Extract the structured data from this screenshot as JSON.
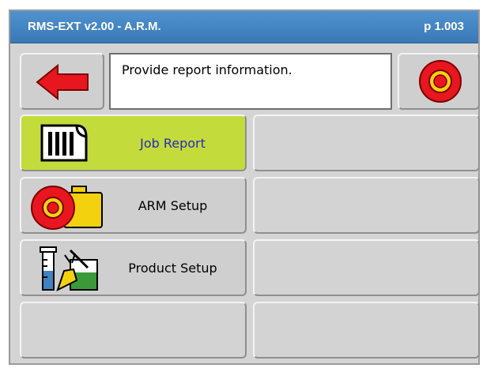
{
  "header": {
    "title": "RMS-EXT v2.00 - A.R.M.",
    "page": "p 1.003"
  },
  "message": {
    "text": "Provide report information."
  },
  "toolbar": {
    "back_icon": "left-arrow-icon",
    "stop_icon": "target-icon"
  },
  "menu": {
    "items": [
      {
        "label": "Job Report",
        "icon": "report-icon",
        "active": true
      },
      {
        "label": "ARM Setup",
        "icon": "reel-canister-icon",
        "active": false
      },
      {
        "label": "Product Setup",
        "icon": "chemistry-icon",
        "active": false
      }
    ]
  },
  "colors": {
    "titlebar": "#3f82c2",
    "active_button": "#c3dc3c",
    "back_arrow": "#e8161f",
    "stop_outer": "#e8161f",
    "stop_inner": "#f4d10f",
    "active_label": "#2a2ab8"
  }
}
